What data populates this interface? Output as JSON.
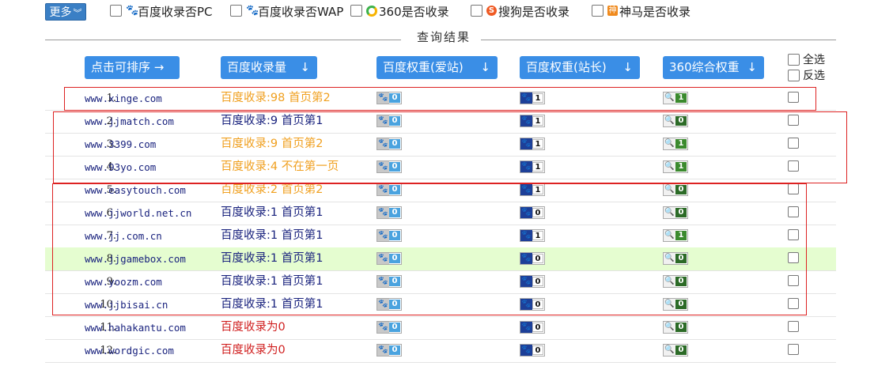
{
  "toolbar": {
    "more_label": "更多",
    "options": [
      {
        "label": "百度收录否PC",
        "icon": "baidu-paw-icon"
      },
      {
        "label": "百度收录否WAP",
        "icon": "baidu-paw-icon"
      },
      {
        "label": "360是否收录",
        "icon": "360-ring-icon"
      },
      {
        "label": "搜狗是否收录",
        "icon": "sogou-s-icon",
        "glyph": "S"
      },
      {
        "label": "神马是否收录",
        "icon": "shenma-icon",
        "glyph": "神"
      }
    ]
  },
  "result_title": "查询结果",
  "headers": {
    "sort": "点击可排序 →",
    "baidu_index": "百度收录量",
    "aizhan_weight": "百度权重(爱站)",
    "zhanzhang_weight": "百度权重(站长)",
    "so360_weight": "360综合权重",
    "arrow": "↓",
    "select_all": "全选",
    "invert": "反选"
  },
  "colors": {
    "accent": "#3a8ee6",
    "orange_status": "#f0a020",
    "blue_status": "#1a237e",
    "red_status": "#d01f1f",
    "highlight_row": "#e5fdd0",
    "annotation_red": "#dd2222"
  },
  "rows": [
    {
      "idx": "1.",
      "site": "www.xinge.com",
      "status": "百度收录:98 首页第2",
      "status_color": "orange",
      "aizhan": "0",
      "zhanzhang": "1",
      "so360": "1"
    },
    {
      "idx": "2.",
      "site": "www.jjmatch.com",
      "status": "百度收录:9 首页第1",
      "status_color": "blue",
      "aizhan": "0",
      "zhanzhang": "1",
      "so360": "0"
    },
    {
      "idx": "3.",
      "site": "www.3399.com",
      "status": "百度收录:9 首页第2",
      "status_color": "orange",
      "aizhan": "0",
      "zhanzhang": "1",
      "so360": "1"
    },
    {
      "idx": "4.",
      "site": "www.93yo.com",
      "status": "百度收录:4 不在第一页",
      "status_color": "orange",
      "aizhan": "0",
      "zhanzhang": "1",
      "so360": "1"
    },
    {
      "idx": "5.",
      "site": "www.easytouch.com",
      "status": "百度收录:2 首页第2",
      "status_color": "orange",
      "aizhan": "0",
      "zhanzhang": "1",
      "so360": "0"
    },
    {
      "idx": "6.",
      "site": "www.jjworld.net.cn",
      "status": "百度收录:1 首页第1",
      "status_color": "blue",
      "aizhan": "0",
      "zhanzhang": "0",
      "so360": "0"
    },
    {
      "idx": "7.",
      "site": "www.jj.com.cn",
      "status": "百度收录:1 首页第1",
      "status_color": "blue",
      "aizhan": "0",
      "zhanzhang": "1",
      "so360": "1"
    },
    {
      "idx": "8.",
      "site": "www.jjgamebox.com",
      "status": "百度收录:1 首页第1",
      "status_color": "blue",
      "aizhan": "0",
      "zhanzhang": "0",
      "so360": "0",
      "highlight": true
    },
    {
      "idx": "9.",
      "site": "www.yoozm.com",
      "status": "百度收录:1 首页第1",
      "status_color": "blue",
      "aizhan": "0",
      "zhanzhang": "0",
      "so360": "0"
    },
    {
      "idx": "10.",
      "site": "www.jjbisai.cn",
      "status": "百度收录:1 首页第1",
      "status_color": "blue",
      "aizhan": "0",
      "zhanzhang": "0",
      "so360": "0"
    },
    {
      "idx": "11.",
      "site": "www.hahakantu.com",
      "status": "百度收录为0",
      "status_color": "red",
      "aizhan": "0",
      "zhanzhang": "0",
      "so360": "0"
    },
    {
      "idx": "12.",
      "site": "www.wordgic.com",
      "status": "百度收录为0",
      "status_color": "red",
      "aizhan": "0",
      "zhanzhang": "0",
      "so360": "0"
    }
  ]
}
